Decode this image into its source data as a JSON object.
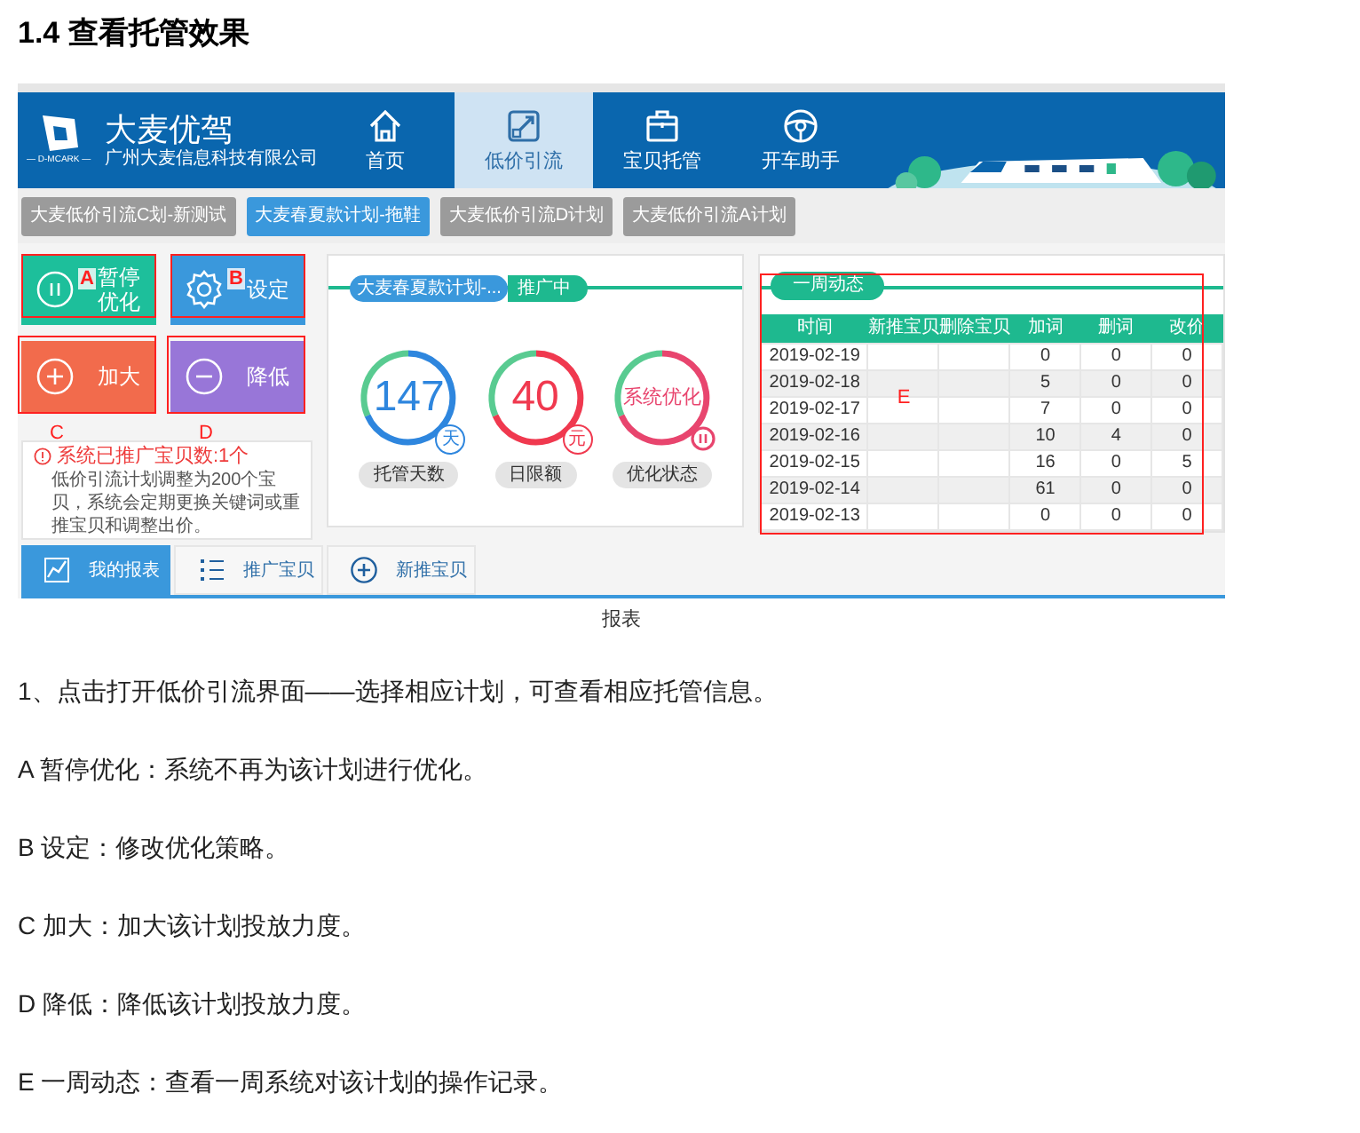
{
  "heading": "1.4 查看托管效果",
  "screenshot": {
    "brand": {
      "name": "大麦优驾",
      "company": "广州大麦信息科技有限公司",
      "logo_text": "— D-MCARK —"
    },
    "nav": [
      {
        "label": "首页",
        "selected": false
      },
      {
        "label": "低价引流",
        "selected": true
      },
      {
        "label": "宝贝托管",
        "selected": false
      },
      {
        "label": "开车助手",
        "selected": false
      }
    ],
    "plans": [
      {
        "label": "大麦低价引流C划-新测试",
        "selected": false
      },
      {
        "label": "大麦春夏款计划-拖鞋",
        "selected": true
      },
      {
        "label": "大麦低价引流D计划",
        "selected": false
      },
      {
        "label": "大麦低价引流A计划",
        "selected": false
      }
    ],
    "actions": [
      {
        "label": "暂停优化",
        "color": "#1dbf9b",
        "marker": "A",
        "marker_below": false
      },
      {
        "label": "设定",
        "color": "#3a98dc",
        "marker": "B",
        "marker_below": false
      },
      {
        "label": "加大",
        "color": "#f26b4c",
        "marker": "C",
        "marker_below": true
      },
      {
        "label": "降低",
        "color": "#9876d8",
        "marker": "D",
        "marker_below": true
      }
    ],
    "notice": {
      "title": "系统已推广宝贝数:1个",
      "text": "低价引流计划调整为200个宝贝，系统会定期更换关键词或重推宝贝和调整出价。"
    },
    "plan_card": {
      "plan": "大麦春夏款计划-...",
      "status": "推广中",
      "gauges": [
        {
          "kind": "number",
          "value": "147",
          "unit": "天",
          "label": "托管天数",
          "color": "#2e86de"
        },
        {
          "kind": "number",
          "value": "40",
          "unit": "元",
          "label": "日限额",
          "color": "#f0394f"
        },
        {
          "kind": "status",
          "value": "系统优化",
          "label": "优化状态",
          "color": "#e8456e"
        }
      ]
    },
    "weekly": {
      "title": "一周动态",
      "marker": "E",
      "columns": [
        "时间",
        "新推宝贝",
        "删除宝贝",
        "加词",
        "删词",
        "改价"
      ],
      "rows": [
        [
          "2019-02-19",
          "",
          "",
          "0",
          "0",
          "0"
        ],
        [
          "2019-02-18",
          "",
          "",
          "5",
          "0",
          "0"
        ],
        [
          "2019-02-17",
          "",
          "",
          "7",
          "0",
          "0"
        ],
        [
          "2019-02-16",
          "",
          "",
          "10",
          "4",
          "0"
        ],
        [
          "2019-02-15",
          "",
          "",
          "16",
          "0",
          "5"
        ],
        [
          "2019-02-14",
          "",
          "",
          "61",
          "0",
          "0"
        ],
        [
          "2019-02-13",
          "",
          "",
          "0",
          "0",
          "0"
        ]
      ]
    },
    "bottom_tabs": [
      {
        "label": "我的报表",
        "selected": true
      },
      {
        "label": "推广宝贝",
        "selected": false
      },
      {
        "label": "新推宝贝",
        "selected": false
      }
    ]
  },
  "caption": "报表",
  "paragraphs": [
    "1、点击打开低价引流界面——选择相应计划，可查看相应托管信息。",
    "A 暂停优化：系统不再为该计划进行优化。",
    "B 设定：修改优化策略。",
    "C 加大：加大该计划投放力度。",
    "D 降低：降低该计划投放力度。",
    "E 一周动态：查看一周系统对该计划的操作记录。"
  ]
}
